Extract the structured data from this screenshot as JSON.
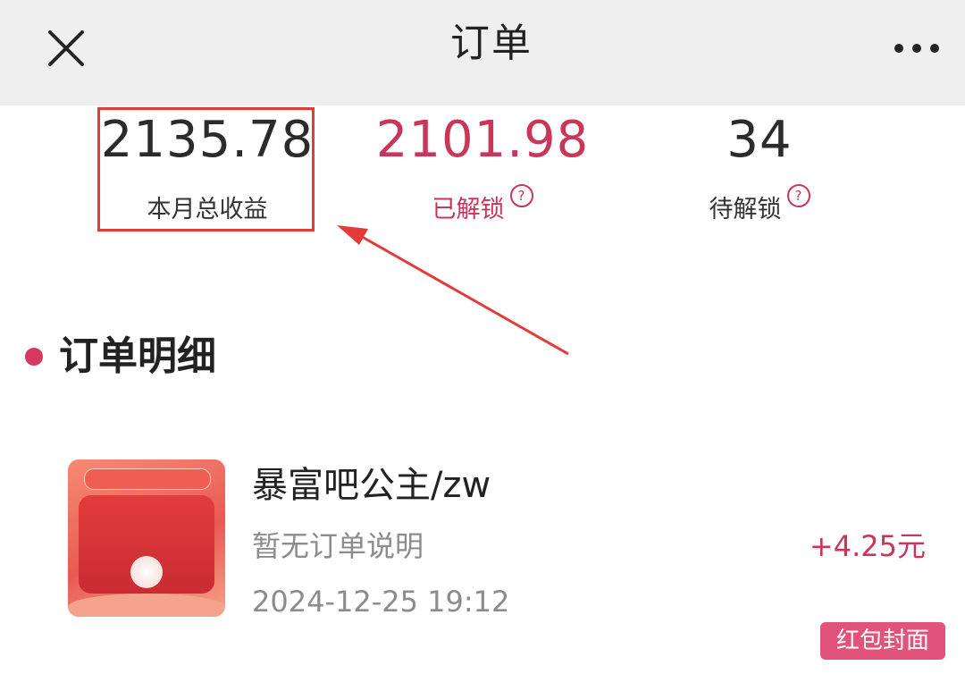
{
  "header": {
    "title": "订单"
  },
  "stats": {
    "total": {
      "value": "2135.78",
      "label": "本月总收益"
    },
    "unlocked": {
      "value": "2101.98",
      "label": "已解锁",
      "help": "?"
    },
    "pending": {
      "value": "34",
      "label": "待解锁",
      "help": "?"
    }
  },
  "section": {
    "title": "订单明细"
  },
  "order": {
    "name": "暴富吧公主/zw",
    "description": "暂无订单说明",
    "time": "2024-12-25 19:12",
    "amount": "+4.25元",
    "tag": "红包封面"
  },
  "colors": {
    "accent": "#c8365a",
    "highlight_box": "#e33a3a",
    "header_bg": "#efefef",
    "tag_bg": "#e1537a"
  },
  "icons": {
    "close": "close-icon",
    "more": "more-icon",
    "help": "help-icon"
  }
}
